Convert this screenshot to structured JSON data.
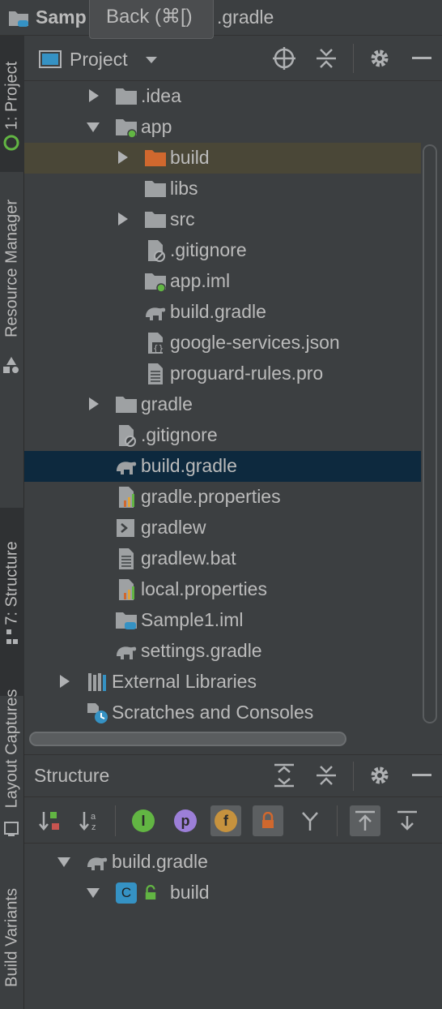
{
  "titlebar": {
    "title_start": "Samp",
    "title_end": ".gradle",
    "tooltip": "Back (⌘[)"
  },
  "left_tabs": {
    "project": "1: Project",
    "resource_manager": "Resource Manager",
    "structure": "7: Structure",
    "layout_captures": "Layout Captures",
    "build_variants": "Build Variants"
  },
  "project_panel": {
    "view_selector": "Project",
    "tree": [
      {
        "label": ".idea",
        "icon": "folder-icon",
        "arrow": "collapsed"
      },
      {
        "label": "app",
        "icon": "module-folder-icon",
        "arrow": "expanded"
      },
      {
        "label": "build",
        "icon": "excluded-folder-icon",
        "arrow": "collapsed"
      },
      {
        "label": "libs",
        "icon": "folder-icon",
        "arrow": "none"
      },
      {
        "label": "src",
        "icon": "folder-icon",
        "arrow": "collapsed"
      },
      {
        "label": ".gitignore",
        "icon": "ignored-file-icon",
        "arrow": "none"
      },
      {
        "label": "app.iml",
        "icon": "module-file-icon",
        "arrow": "none"
      },
      {
        "label": "build.gradle",
        "icon": "gradle-icon",
        "arrow": "none"
      },
      {
        "label": "google-services.json",
        "icon": "json-file-icon",
        "arrow": "none"
      },
      {
        "label": "proguard-rules.pro",
        "icon": "text-file-icon",
        "arrow": "none"
      },
      {
        "label": "gradle",
        "icon": "folder-icon",
        "arrow": "collapsed"
      },
      {
        "label": ".gitignore",
        "icon": "ignored-file-icon",
        "arrow": "none"
      },
      {
        "label": "build.gradle",
        "icon": "gradle-icon",
        "arrow": "none"
      },
      {
        "label": "gradle.properties",
        "icon": "properties-file-icon",
        "arrow": "none"
      },
      {
        "label": "gradlew",
        "icon": "shell-script-icon",
        "arrow": "none"
      },
      {
        "label": "gradlew.bat",
        "icon": "text-file-icon",
        "arrow": "none"
      },
      {
        "label": "local.properties",
        "icon": "properties-file-icon",
        "arrow": "none"
      },
      {
        "label": "Sample1.iml",
        "icon": "project-file-icon",
        "arrow": "none"
      },
      {
        "label": "settings.gradle",
        "icon": "gradle-icon",
        "arrow": "none"
      },
      {
        "label": "External Libraries",
        "icon": "libraries-icon",
        "arrow": "collapsed"
      },
      {
        "label": "Scratches and Consoles",
        "icon": "scratches-icon",
        "arrow": "none"
      }
    ]
  },
  "structure_panel": {
    "title": "Structure",
    "toolbar_badges": {
      "interface": "I",
      "property": "p",
      "field": "f"
    },
    "tree": [
      {
        "label": "build.gradle",
        "icon": "gradle-icon",
        "arrow": "expanded"
      },
      {
        "label": "build",
        "icon": "class-icon",
        "arrow": "expanded",
        "class_letter": "C"
      }
    ]
  },
  "colors": {
    "background": "#3c3f41",
    "selection": "#0d293e",
    "hover": "#4a4737",
    "text": "#bbbbbb",
    "excluded_folder": "#d0682e",
    "folder": "#9ea1a3",
    "vcs_green": "#62b543"
  }
}
